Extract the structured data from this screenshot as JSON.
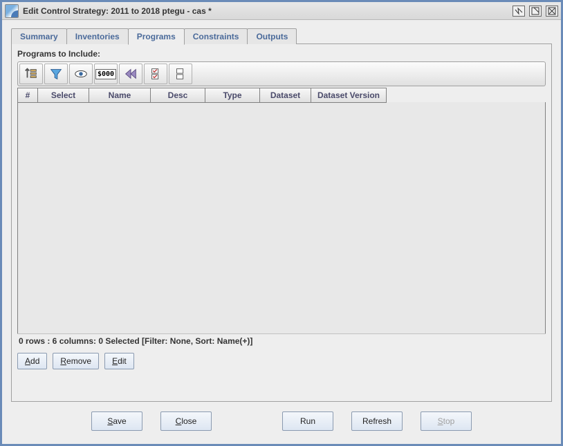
{
  "window_title": "Edit Control Strategy: 2011 to 2018 ptegu - cas *",
  "tabs": {
    "summary": "Summary",
    "inventories": "Inventories",
    "programs": "Programs",
    "constraints": "Constraints",
    "outputs": "Outputs"
  },
  "section_label": "Programs to Include:",
  "columns": {
    "num": "#",
    "select": "Select",
    "name": "Name",
    "desc": "Desc",
    "type": "Type",
    "dataset": "Dataset",
    "dataset_version": "Dataset Version"
  },
  "rows": [],
  "status_text": "0 rows : 6 columns: 0 Selected [Filter: None, Sort: Name(+)]",
  "crud": {
    "add_prefix": "A",
    "add_rest": "dd",
    "remove_prefix": "R",
    "remove_rest": "emove",
    "edit_prefix": "E",
    "edit_rest": "dit"
  },
  "actions": {
    "save_prefix": "S",
    "save_rest": "ave",
    "close_prefix": "C",
    "close_rest": "lose",
    "run": "Run",
    "refresh": "Refresh",
    "stop_prefix": "S",
    "stop_rest": "top"
  },
  "money_icon_text": "$000"
}
